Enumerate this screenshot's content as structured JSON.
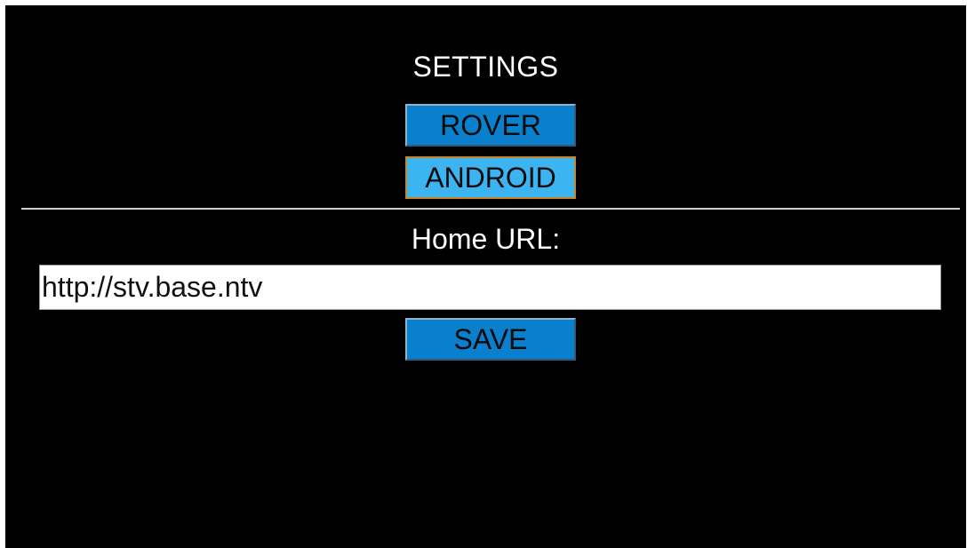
{
  "settings": {
    "title": "SETTINGS",
    "rover_label": "ROVER",
    "android_label": "ANDROID",
    "home_url_label": "Home URL:",
    "home_url_value": "http://stv.base.ntv",
    "save_label": "SAVE",
    "selected_mode": "ANDROID"
  },
  "colors": {
    "background": "#000000",
    "button": "#0a7fcb",
    "button_selected": "#3db4f2",
    "selected_border": "#c8842a",
    "text": "#ffffff"
  }
}
